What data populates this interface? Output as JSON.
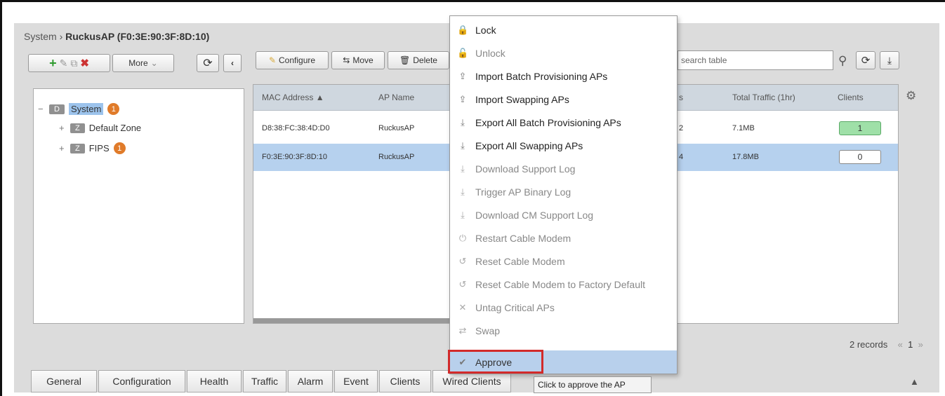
{
  "breadcrumb": {
    "root": "System",
    "separator": "›",
    "current": "RuckusAP (F0:3E:90:3F:8D:10)"
  },
  "left_toolbar": {
    "more_label": "More"
  },
  "right_toolbar": {
    "configure_label": "Configure",
    "move_label": "Move",
    "delete_label": "Delete",
    "search_placeholder": "search table"
  },
  "tree": {
    "root": {
      "badge": "D",
      "label": "System",
      "count": "1"
    },
    "children": [
      {
        "badge": "Z",
        "label": "Default Zone"
      },
      {
        "badge": "Z",
        "label": "FIPS",
        "count": "1"
      }
    ]
  },
  "table": {
    "columns": {
      "mac": "MAC Address ▲",
      "ap_name": "AP Name",
      "clients_partial": "s",
      "traffic": "Total Traffic (1hr)",
      "clients": "Clients"
    },
    "rows": [
      {
        "mac": "D8:38:FC:38:4D:D0",
        "ap_name": "RuckusAP",
        "partial": "2",
        "traffic": "7.1MB",
        "clients": "1"
      },
      {
        "mac": "F0:3E:90:3F:8D:10",
        "ap_name": "RuckusAP",
        "partial": "4",
        "traffic": "17.8MB",
        "clients": "0"
      }
    ]
  },
  "records": {
    "label": "2 records",
    "prev": "«",
    "page": "1",
    "next": "»"
  },
  "tabs": [
    "General",
    "Configuration",
    "Health",
    "Traffic",
    "Alarm",
    "Event",
    "Clients",
    "Wired Clients"
  ],
  "menu": [
    {
      "icon": "lock-icon",
      "glyph": "🔒",
      "label": "Lock",
      "state": "active"
    },
    {
      "icon": "unlock-icon",
      "glyph": "🔓",
      "label": "Unlock",
      "state": "disabled"
    },
    {
      "icon": "upload-icon",
      "glyph": "⇪",
      "label": "Import Batch Provisioning APs",
      "state": "active"
    },
    {
      "icon": "upload-icon",
      "glyph": "⇪",
      "label": "Import Swapping APs",
      "state": "active"
    },
    {
      "icon": "download-icon",
      "glyph": "⤓",
      "label": "Export All Batch Provisioning APs",
      "state": "active"
    },
    {
      "icon": "download-icon",
      "glyph": "⤓",
      "label": "Export All Swapping APs",
      "state": "active"
    },
    {
      "icon": "download-icon",
      "glyph": "⤓",
      "label": "Download Support Log",
      "state": "disabled"
    },
    {
      "icon": "download-icon",
      "glyph": "⤓",
      "label": "Trigger AP Binary Log",
      "state": "disabled"
    },
    {
      "icon": "download-icon",
      "glyph": "⤓",
      "label": "Download CM Support Log",
      "state": "disabled"
    },
    {
      "icon": "power-icon",
      "glyph": "⏻",
      "label": "Restart Cable Modem",
      "state": "disabled"
    },
    {
      "icon": "reset-icon",
      "glyph": "↺",
      "label": "Reset Cable Modem",
      "state": "disabled"
    },
    {
      "icon": "reset-icon",
      "glyph": "↺",
      "label": "Reset Cable Modem to Factory Default",
      "state": "disabled"
    },
    {
      "icon": "close-icon",
      "glyph": "✕",
      "label": "Untag Critical APs",
      "state": "disabled"
    },
    {
      "icon": "swap-icon",
      "glyph": "⇄",
      "label": "Swap",
      "state": "disabled"
    },
    {
      "icon": "checkmark-icon",
      "glyph": "✔",
      "label": "Approve",
      "state": "approve"
    }
  ],
  "tooltip": "Click to approve the AP",
  "colors": {
    "highlight": "#d22a2a",
    "selection": "#b6d1ee",
    "badge_orange": "#e07b2a",
    "clients_green": "#9fe0a8"
  }
}
